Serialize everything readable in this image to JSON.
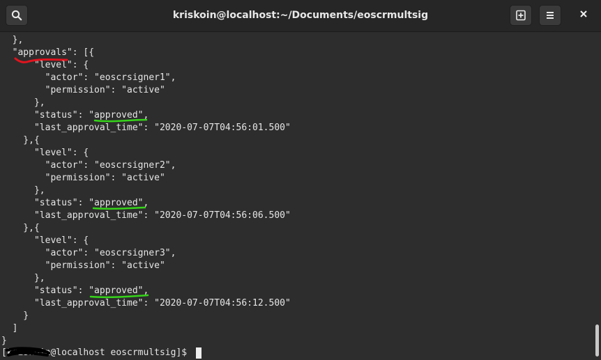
{
  "window": {
    "title": "kriskoin@localhost:~/Documents/eoscrmultsig"
  },
  "header": {
    "search_icon": "search-icon",
    "new_tab_icon": "new-tab-icon",
    "menu_icon": "hamburger-menu-icon",
    "close_icon": "close-icon"
  },
  "terminal": {
    "lines": [
      "  },",
      "  \"approvals\": [{",
      "      \"level\": {",
      "        \"actor\": \"eoscrsigner1\",",
      "        \"permission\": \"active\"",
      "      },",
      "      \"status\": \"approved\",",
      "      \"last_approval_time\": \"2020-07-07T04:56:01.500\"",
      "    },{",
      "      \"level\": {",
      "        \"actor\": \"eoscrsigner2\",",
      "        \"permission\": \"active\"",
      "      },",
      "      \"status\": \"approved\",",
      "      \"last_approval_time\": \"2020-07-07T04:56:06.500\"",
      "    },{",
      "      \"level\": {",
      "        \"actor\": \"eoscrsigner3\",",
      "        \"permission\": \"active\"",
      "      },",
      "      \"status\": \"approved\",",
      "      \"last_approval_time\": \"2020-07-07T04:56:12.500\"",
      "    }",
      "  ]",
      "}",
      "[kriskoin@localhost eoscrmultsig]$ "
    ]
  },
  "colors": {
    "background": "#2d2d2d",
    "titlebar": "#262626",
    "text": "#e6e6e6",
    "red_annotation": "#e0141e",
    "green_annotation": "#36d41a"
  }
}
